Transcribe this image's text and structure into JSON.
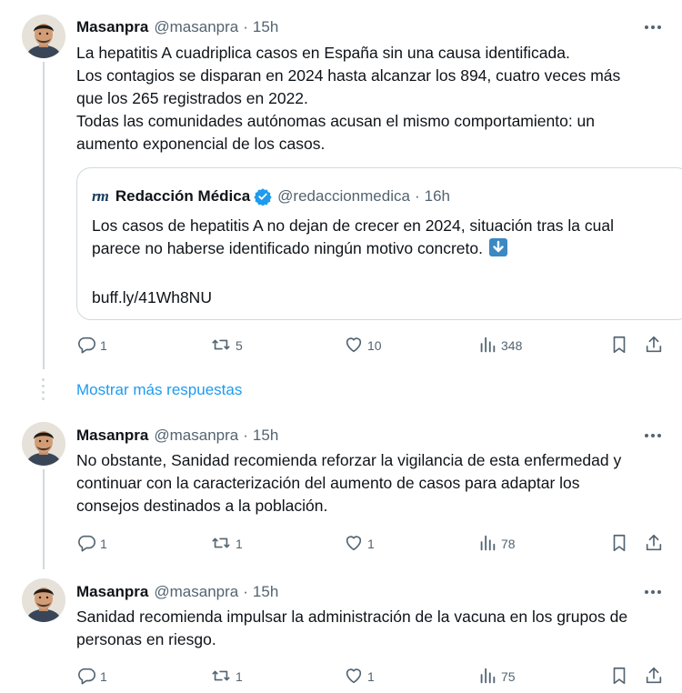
{
  "tweets": [
    {
      "author_name": "Masanpra",
      "handle": "@masanpra",
      "separator": "·",
      "time": "15h",
      "lines": [
        "La hepatitis A cuadriplica casos en España sin una causa identificada.",
        "Los contagios se disparan en 2024 hasta alcanzar los 894, cuatro veces más",
        "que los 265 registrados en 2022.",
        "Todas las comunidades autónomas acusan el mismo comportamiento: un",
        "aumento exponencial de los casos."
      ],
      "quote": {
        "logo": "rm",
        "author_name": "Redacción Médica",
        "handle": "@redaccionmedica",
        "separator": "·",
        "time": "16h",
        "lines": [
          "Los casos de hepatitis A no dejan de crecer en 2024, situación tras la cual",
          "parece no haberse identificado ningún motivo concreto."
        ],
        "emoji": "down-arrow-emoji",
        "link": "buff.ly/41Wh8NU"
      },
      "stats": {
        "replies": "1",
        "retweets": "5",
        "likes": "10",
        "views": "348"
      }
    },
    {
      "author_name": "Masanpra",
      "handle": "@masanpra",
      "separator": "·",
      "time": "15h",
      "lines": [
        "No obstante, Sanidad recomienda reforzar la vigilancia de esta enfermedad y",
        "continuar con la caracterización del aumento de casos para adaptar los",
        "consejos destinados a la población."
      ],
      "stats": {
        "replies": "1",
        "retweets": "1",
        "likes": "1",
        "views": "78"
      }
    },
    {
      "author_name": "Masanpra",
      "handle": "@masanpra",
      "separator": "·",
      "time": "15h",
      "lines": [
        "Sanidad recomienda impulsar la administración de la vacuna en los grupos de",
        "personas en riesgo."
      ],
      "stats": {
        "replies": "1",
        "retweets": "1",
        "likes": "1",
        "views": "75"
      }
    }
  ],
  "show_more_replies": "Mostrar más respuestas",
  "icons": {
    "more": "more-horizontal-icon",
    "reply": "reply-icon",
    "retweet": "retweet-icon",
    "like": "heart-icon",
    "views": "views-chart-icon",
    "bookmark": "bookmark-icon",
    "share": "share-icon",
    "verified": "verified-badge-icon"
  },
  "colors": {
    "text": "#0f1419",
    "secondary": "#536471",
    "link": "#1d9bf0",
    "border": "#cfd9de",
    "verified": "#1d9bf0"
  }
}
